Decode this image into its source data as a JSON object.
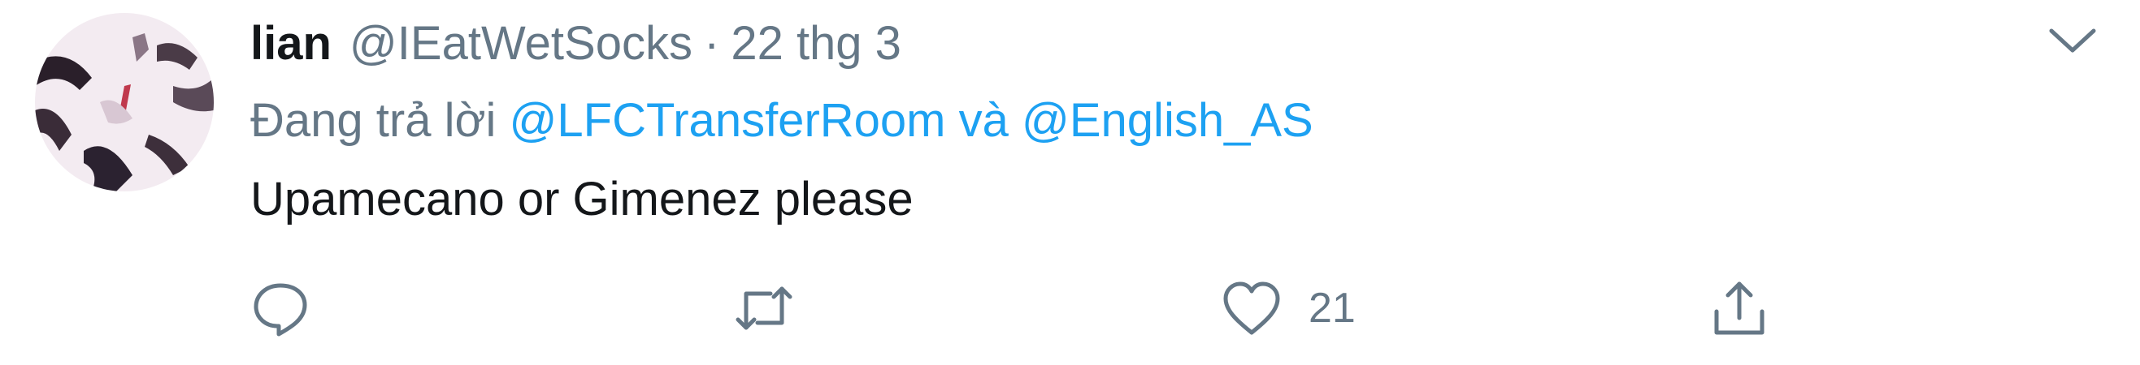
{
  "tweet": {
    "display_name": "lian",
    "handle": "@IEatWetSocks",
    "separator": "·",
    "date": "22 thg 3",
    "reply_prefix": "Đang trả lời",
    "reply_mentions": [
      "@LFCTransferRoom",
      "@English_AS"
    ],
    "reply_conjunction": "và",
    "text": "Upamecano or Gimenez please"
  },
  "actions": {
    "reply_icon": "speech-bubble-icon",
    "retweet_icon": "retweet-arrows-icon",
    "like_icon": "heart-outline-icon",
    "like_count": "21",
    "share_icon": "share-upload-icon"
  },
  "menu_icon": "chevron-down-icon",
  "colors": {
    "text_primary": "#14171a",
    "text_secondary": "#657786",
    "link": "#1da1f2",
    "avatar_bg": "#f1e9ef"
  }
}
